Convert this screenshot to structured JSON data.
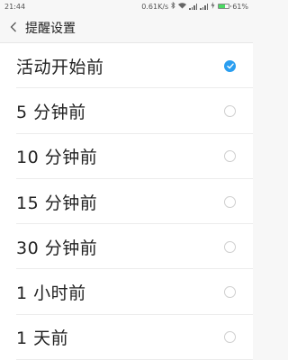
{
  "status_bar": {
    "time": "21:44",
    "speed": "0.61K/s",
    "battery_text": "61%",
    "battery_level": 0.61,
    "icons": [
      "bluetooth-icon",
      "wifi-icon",
      "signal-icon",
      "signal-icon",
      "charging-icon",
      "battery-icon"
    ]
  },
  "header": {
    "title": "提醒设置",
    "back_icon": "chevron-left-icon"
  },
  "options": [
    {
      "label": "活动开始前",
      "selected": true
    },
    {
      "label": "5 分钟前",
      "selected": false
    },
    {
      "label": "10 分钟前",
      "selected": false
    },
    {
      "label": "15 分钟前",
      "selected": false
    },
    {
      "label": "30 分钟前",
      "selected": false
    },
    {
      "label": "1 小时前",
      "selected": false
    },
    {
      "label": "1 天前",
      "selected": false
    }
  ],
  "colors": {
    "accent": "#2a9ef0",
    "battery": "#4cd964"
  }
}
